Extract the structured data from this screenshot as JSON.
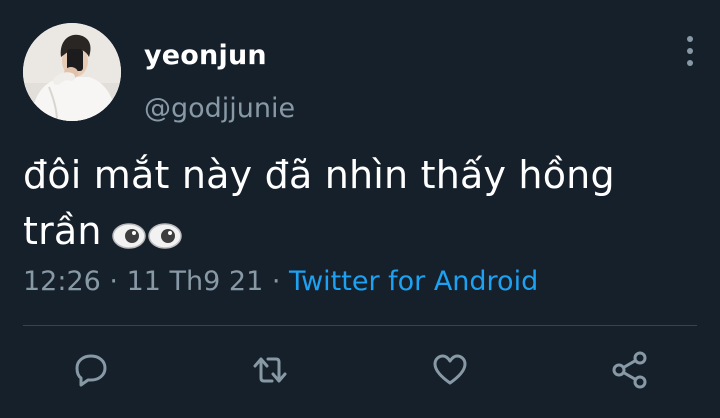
{
  "user": {
    "display_name": "yeonjun",
    "handle": "@godjjunie"
  },
  "tweet": {
    "text": "đôi mắt này đã nhìn thấy hồng trần",
    "emoji": "👀",
    "time": "12:26",
    "separator": "·",
    "date": "11 Th9 21",
    "source": "Twitter for Android"
  },
  "icons": {
    "more": "more-vertical-icon",
    "reply": "reply-icon",
    "retweet": "retweet-icon",
    "like": "heart-icon",
    "share": "share-icon"
  },
  "colors": {
    "background": "#15202b",
    "text": "#ffffff",
    "secondary": "#8899a6",
    "link": "#1da1f2",
    "divider": "#38444d"
  }
}
